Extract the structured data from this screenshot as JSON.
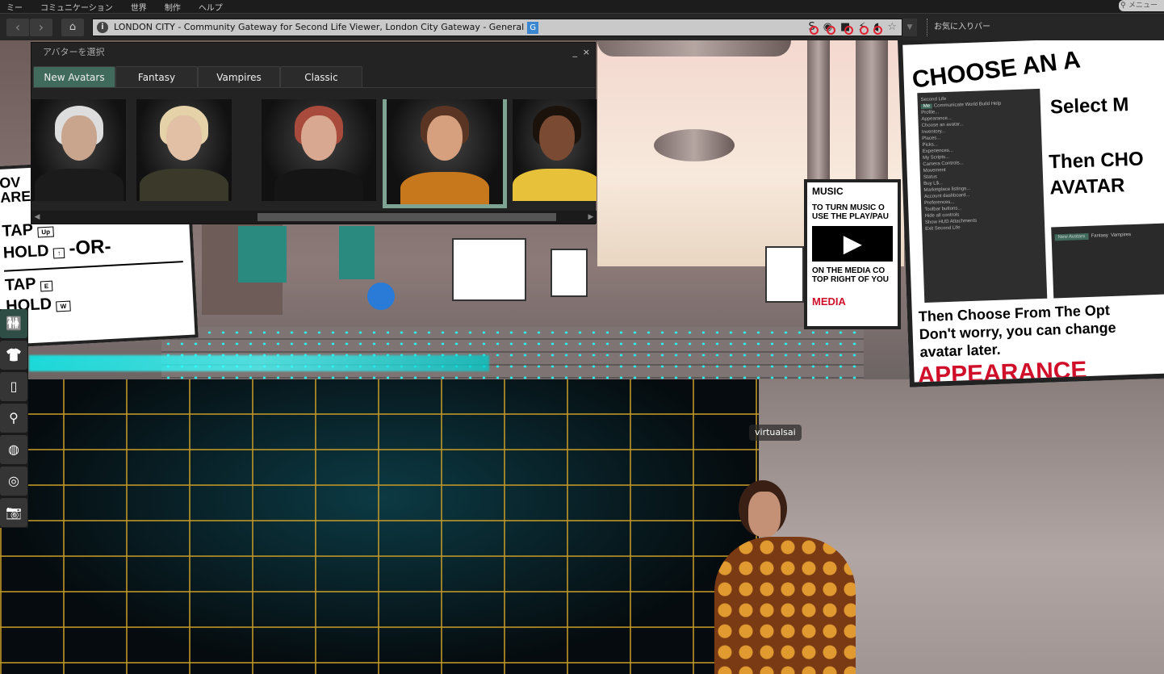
{
  "menubar": {
    "items": [
      "ミー",
      "コミュニケーション",
      "世界",
      "制作",
      "ヘルプ"
    ],
    "search_placeholder": "メニュー"
  },
  "navbar": {
    "back": "back-icon",
    "forward": "forward-icon",
    "home": "home-icon",
    "location": "LONDON CITY - Community Gateway for Second Life Viewer, London City Gateway - General",
    "maturity_badge": "G",
    "parcel_icons": [
      "no-scripts-icon",
      "no-see-icon",
      "no-build-icon",
      "no-push-icon",
      "no-voice-icon"
    ],
    "favorite_icon": "star-icon",
    "favorites_label": "お気に入りバー"
  },
  "picker": {
    "title": "アバターを選択",
    "minimize": "_",
    "close": "×",
    "tabs": [
      "New Avatars",
      "Fantasy",
      "Vampires",
      "Classic"
    ],
    "active_tab": 0,
    "avatars": [
      {
        "skin": "#c9a58e",
        "hair": "#ddd",
        "body": "#1b1b1b"
      },
      {
        "skin": "#e2c0a6",
        "hair": "#e6d2a8",
        "body": "#3b3a2a"
      },
      {
        "skin": "#d9a890",
        "hair": "#a84a3c",
        "body": "#151515"
      },
      {
        "skin": "#d6a07f",
        "hair": "#5a3523",
        "body": "#c8781c"
      },
      {
        "skin": "#7a4a32",
        "hair": "#1b120c",
        "body": "#e7c13a"
      }
    ],
    "selected_avatar": 3
  },
  "toolbar": {
    "buttons": [
      "avatar-icon",
      "clothing-icon",
      "inventory-icon",
      "search-icon",
      "destinations-icon",
      "voice-icon",
      "snapshot-icon"
    ],
    "active": 0
  },
  "accent": "#3f6a5c",
  "world": {
    "nametag": "virtualsai",
    "sign_left": {
      "lines": [
        "TAP",
        "HOLD",
        "-OR-",
        "TAP",
        "HOLD"
      ],
      "keys": [
        "Up",
        "↑",
        "E",
        "W"
      ],
      "edge": [
        "OV",
        "ARE"
      ]
    },
    "sign_music": {
      "title": "MUSIC",
      "lines": [
        "TO TURN MUSIC O",
        "USE THE PLAY/PAU",
        "ON THE MEDIA CO",
        "TOP RIGHT OF YOU"
      ],
      "footer": "MEDIA"
    },
    "sign_right": {
      "title": "CHOOSE AN A",
      "select": "Select M",
      "then": "Then CHO",
      "avatar": "AVATAR",
      "body1": "Then Choose From The Opt",
      "body2": "Don't worry, you can change",
      "body3": "avatar later.",
      "footer": "APPEARANCE",
      "menu": {
        "app": "Second Life",
        "tabs": [
          "Me",
          "Communicate",
          "World",
          "Build",
          "Help"
        ],
        "items": [
          "Profile...",
          "Appearance...",
          "Choose an avatar...",
          "Inventory...",
          "Places...",
          "Picks...",
          "Experiences...",
          "My Scripts...",
          "Camera Controls...",
          "Movement",
          "Status",
          "Buy L$...",
          "Marketplace listings...",
          "Account dashboard...",
          "Preferences...",
          "Toolbar buttons...",
          "Hide all controls",
          "Show HUD Attachments",
          "Exit Second Life"
        ]
      },
      "mini_tabs": [
        "New Avatars",
        "Fantasy",
        "Vampires"
      ]
    }
  }
}
